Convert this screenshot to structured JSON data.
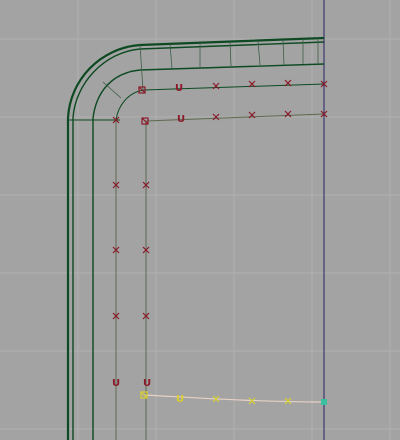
{
  "viewport": {
    "background_color": "#a3a3a3",
    "grid_color": "#b0b0b0"
  },
  "colors": {
    "mesh_green": "#0d4a22",
    "curve_olive": "#5e6a50",
    "cv_red": "#8b1a2a",
    "selected_yellow": "#d8d030",
    "selected_curve": "#e8d2c4",
    "axis_line": "#262660",
    "cv_endpoint": "#38c0a0"
  },
  "icons": {
    "cv_marker": "x-mark-icon",
    "cv_origin": "square-marker-icon",
    "cv_direction": "u-direction-label"
  },
  "markers": {
    "u_label": "U"
  },
  "selection": {
    "active_curve": "bottom-curve"
  }
}
